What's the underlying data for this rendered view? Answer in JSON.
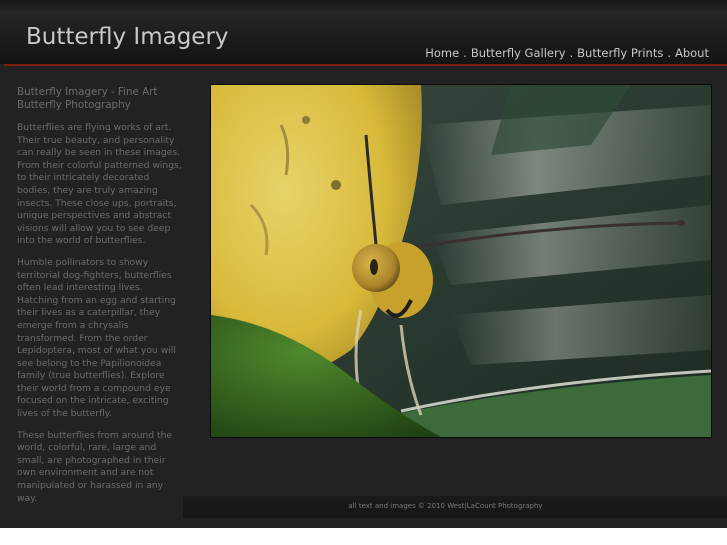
{
  "site": {
    "title": "Butterfly Imagery"
  },
  "nav": {
    "items": [
      {
        "label": "Home"
      },
      {
        "label": "Butterfly Gallery"
      },
      {
        "label": "Butterfly Prints"
      },
      {
        "label": "About"
      }
    ],
    "separator": "."
  },
  "sidebar": {
    "heading": "Butterfly Imagery - Fine Art Butterfly Photography",
    "paragraphs": [
      "Butterflies are flying works of art. Their true beauty, and personality can really be seen in these images. From their colorful patterned wings, to their intricately decorated bodies, they are truly amazing insects. These close ups, portraits, unique perspectives and abstract visions will allow you to see deep into the world of butterflies.",
      "Humble pollinators to showy territorial dog-fighters, butterflies often lead interesting lives. Hatching from an egg and starting their lives as a caterpillar, they emerge from a chrysalis transformed. From the order Lepidoptera, most of what you will see belong to the Papilionoidea family (true butterflies). Explore their world from a compound eye focused on the intricate, exciting lives of the butterfly.",
      "These butterflies from around the world, colorful, rare, large and small, are photographed in their own environment and are not manipulated or harassed in any way."
    ]
  },
  "footer": {
    "text": "all text and images ©  2010 West|LaCount Photography"
  },
  "colors": {
    "background": "#222222",
    "header_rule": "#7a1f12",
    "title_text": "#c8c8c8",
    "body_text": "#6c6c6c"
  }
}
